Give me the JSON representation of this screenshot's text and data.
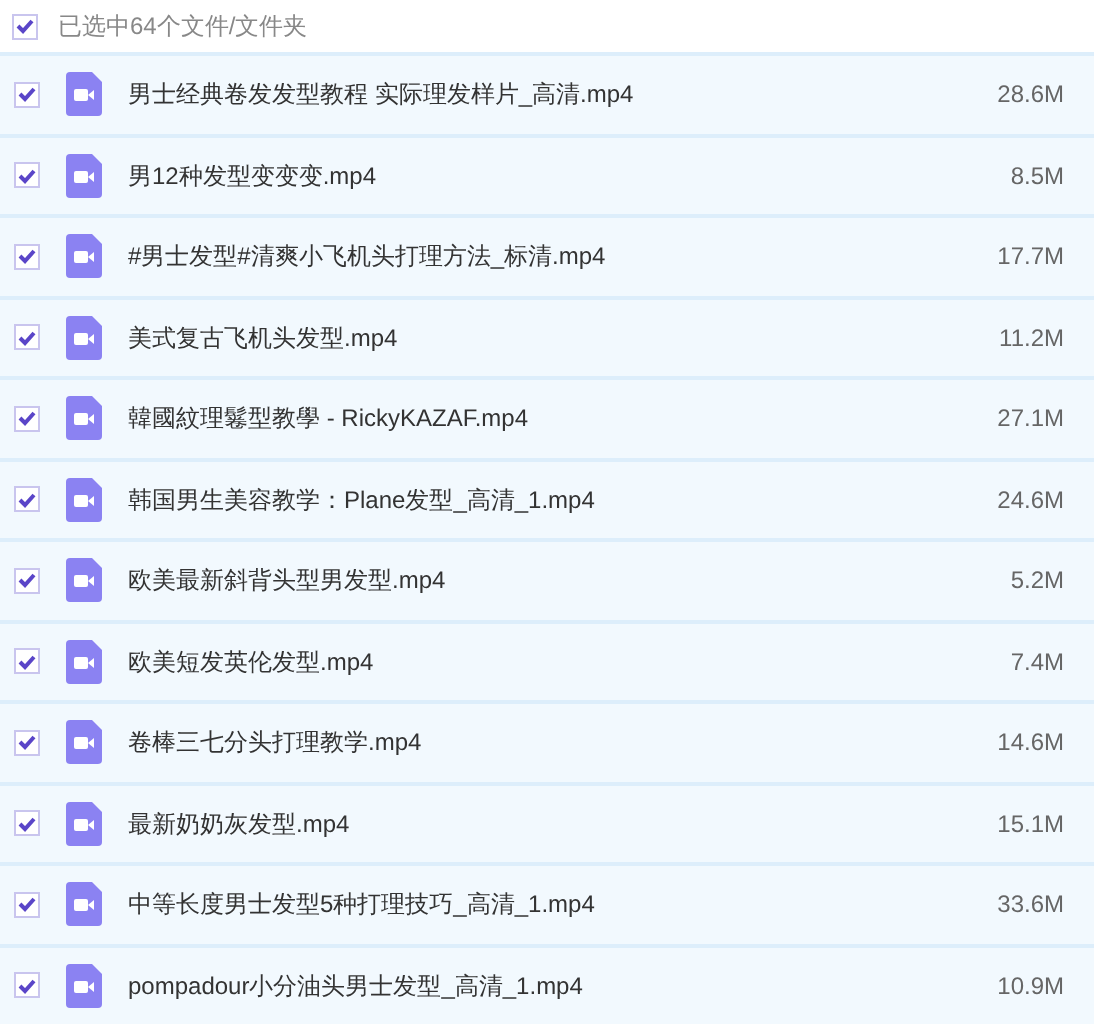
{
  "header": {
    "checked": true,
    "label": "已选中64个文件/文件夹"
  },
  "files": [
    {
      "name": "男士经典卷发发型教程 实际理发样片_高清.mp4",
      "size": "28.6M",
      "checked": true
    },
    {
      "name": "男12种发型变变变.mp4",
      "size": "8.5M",
      "checked": true
    },
    {
      "name": "#男士发型#清爽小飞机头打理方法_标清.mp4",
      "size": "17.7M",
      "checked": true
    },
    {
      "name": "美式复古飞机头发型.mp4",
      "size": "11.2M",
      "checked": true
    },
    {
      "name": "韓國紋理鬈型教學 - RickyKAZAF.mp4",
      "size": "27.1M",
      "checked": true
    },
    {
      "name": "韩国男生美容教学：Plane发型_高清_1.mp4",
      "size": "24.6M",
      "checked": true
    },
    {
      "name": "欧美最新斜背头型男发型.mp4",
      "size": "5.2M",
      "checked": true
    },
    {
      "name": "欧美短发英伦发型.mp4",
      "size": "7.4M",
      "checked": true
    },
    {
      "name": "卷棒三七分头打理教学.mp4",
      "size": "14.6M",
      "checked": true
    },
    {
      "name": "最新奶奶灰发型.mp4",
      "size": "15.1M",
      "checked": true
    },
    {
      "name": "中等长度男士发型5种打理技巧_高清_1.mp4",
      "size": "33.6M",
      "checked": true
    },
    {
      "name": "pompadour小分油头男士发型_高清_1.mp4",
      "size": "10.9M",
      "checked": true
    }
  ]
}
